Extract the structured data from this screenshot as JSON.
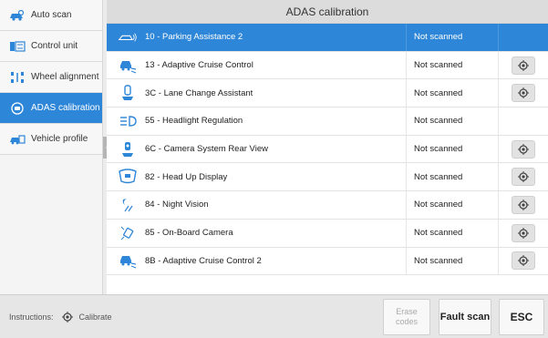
{
  "sidebar": {
    "items": [
      {
        "label": "Auto scan",
        "icon": "car-scan-icon"
      },
      {
        "label": "Control unit",
        "icon": "control-unit-icon"
      },
      {
        "label": "Wheel alignment",
        "icon": "wheel-alignment-icon"
      },
      {
        "label": "ADAS calibration",
        "icon": "adas-icon",
        "active": true
      },
      {
        "label": "Vehicle profile",
        "icon": "vehicle-profile-icon"
      }
    ]
  },
  "header": {
    "title": "ADAS calibration"
  },
  "rows": [
    {
      "name": "10 - Parking Assistance 2",
      "status": "Not scanned",
      "icon": "parking-sensor-icon",
      "calibrate": false,
      "selected": true
    },
    {
      "name": "13 - Adaptive Cruise Control",
      "status": "Not scanned",
      "icon": "cruise-control-icon",
      "calibrate": true
    },
    {
      "name": "3C - Lane Change Assistant",
      "status": "Not scanned",
      "icon": "lane-change-icon",
      "calibrate": true
    },
    {
      "name": "55 - Headlight Regulation",
      "status": "Not scanned",
      "icon": "headlight-icon",
      "calibrate": false
    },
    {
      "name": "6C - Camera System Rear View",
      "status": "Not scanned",
      "icon": "rear-camera-icon",
      "calibrate": true
    },
    {
      "name": "82 - Head Up Display",
      "status": "Not scanned",
      "icon": "head-up-display-icon",
      "calibrate": true
    },
    {
      "name": "84 - Night Vision",
      "status": "Not scanned",
      "icon": "night-vision-icon",
      "calibrate": true
    },
    {
      "name": "85 - On-Board Camera",
      "status": "Not scanned",
      "icon": "onboard-camera-icon",
      "calibrate": true
    },
    {
      "name": "8B - Adaptive Cruise Control 2",
      "status": "Not scanned",
      "icon": "cruise-control-icon",
      "calibrate": true
    }
  ],
  "footer": {
    "instructions_label": "Instructions:",
    "calibrate_label": "Calibrate",
    "erase_line1": "Erase",
    "erase_line2": "codes",
    "fault_scan": "Fault scan",
    "esc": "ESC"
  },
  "colors": {
    "accent": "#2e86d8",
    "icon_blue": "#2e86d8",
    "header_bg": "#dcdcdc"
  }
}
